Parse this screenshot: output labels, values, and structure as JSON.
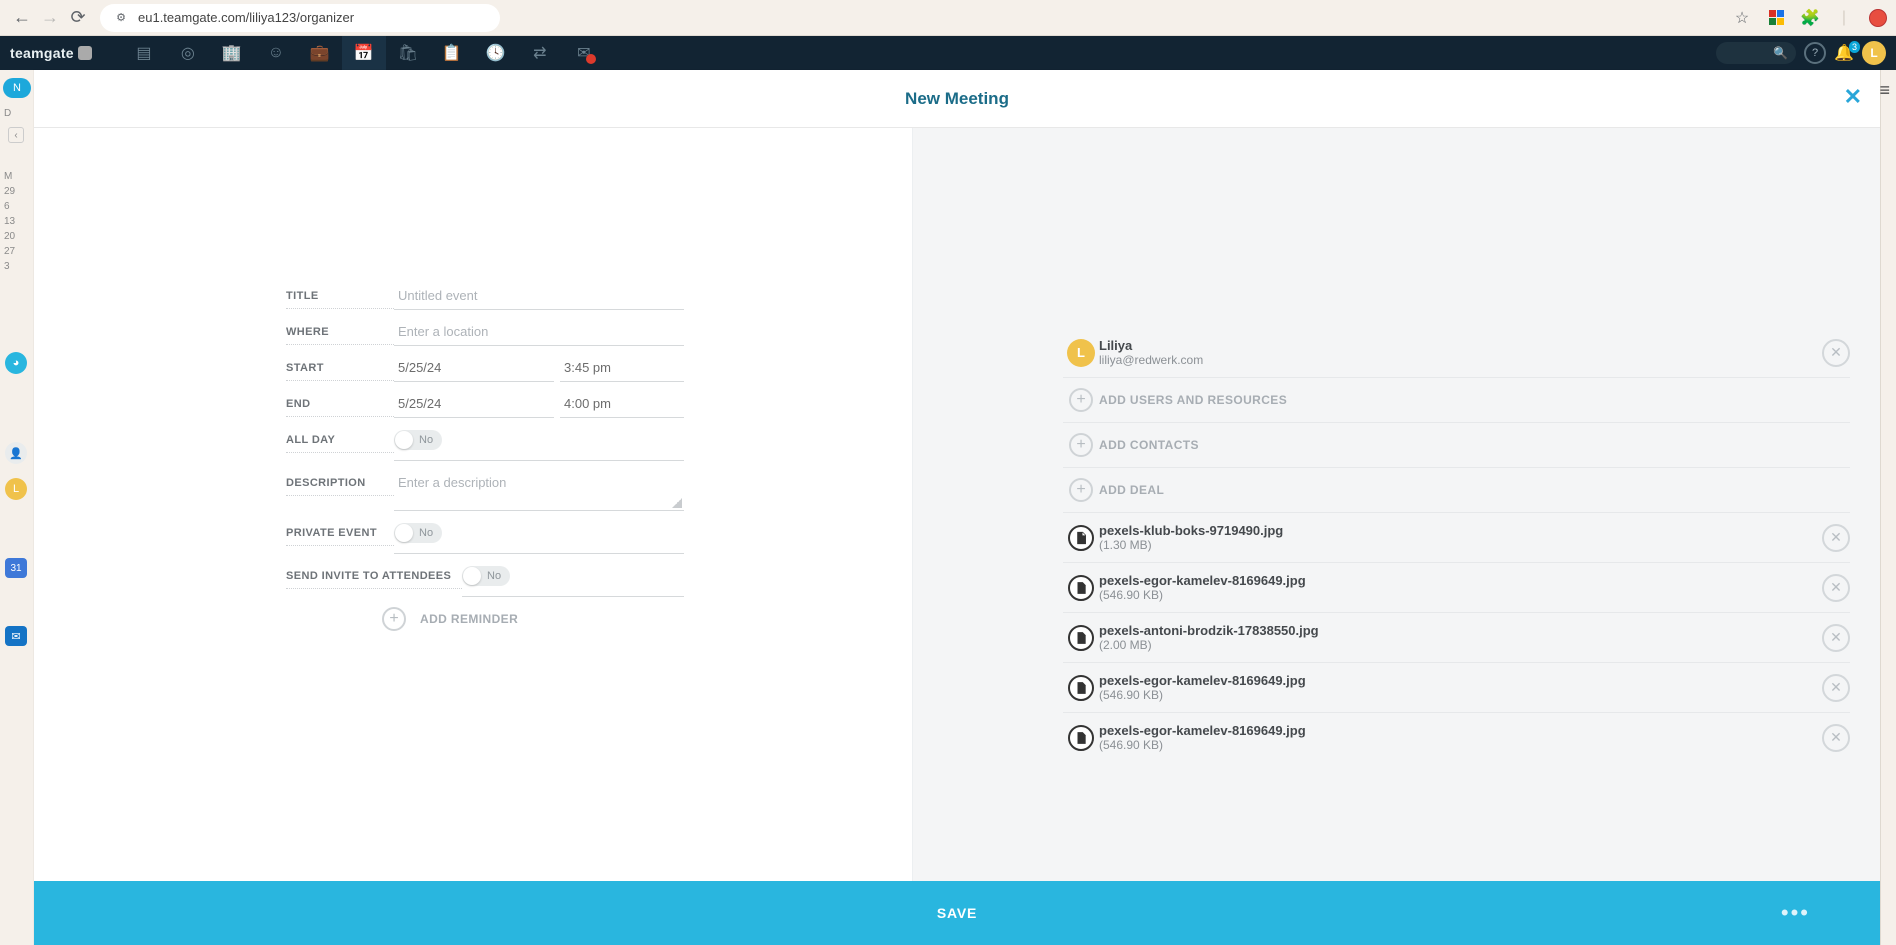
{
  "browser": {
    "url": "eu1.teamgate.com/liliya123/organizer"
  },
  "topbar": {
    "logo_text": "teamgate",
    "notif_count": "3",
    "avatar_initial": "L"
  },
  "under": {
    "new_btn": "N",
    "day_label": "D",
    "month_label": "M",
    "rows": [
      "29",
      "6",
      "13",
      "20",
      "27",
      "3"
    ],
    "google_cal": "31"
  },
  "modal": {
    "title": "New Meeting",
    "labels": {
      "title": "TITLE",
      "where": "WHERE",
      "start": "START",
      "end": "END",
      "allday": "ALL DAY",
      "description": "DESCRIPTION",
      "private": "PRIVATE EVENT",
      "send_invite": "SEND INVITE TO ATTENDEES",
      "add_reminder": "ADD REMINDER"
    },
    "placeholders": {
      "title": "Untitled event",
      "where": "Enter a location",
      "description": "Enter a description"
    },
    "values": {
      "start_date": "5/25/24",
      "start_time": "3:45 pm",
      "end_date": "5/25/24",
      "end_time": "4:00 pm",
      "allday": "No",
      "private": "No",
      "send_invite": "No"
    },
    "side": {
      "attendee": {
        "name": "Liliya",
        "email": "liliya@redwerk.com",
        "initial": "L"
      },
      "actions": {
        "add_users": "ADD USERS AND RESOURCES",
        "add_contacts": "ADD CONTACTS",
        "add_deal": "ADD DEAL"
      },
      "attachments": [
        {
          "name": "pexels-klub-boks-9719490.jpg",
          "size": "(1.30 MB)"
        },
        {
          "name": "pexels-egor-kamelev-8169649.jpg",
          "size": "(546.90 KB)"
        },
        {
          "name": "pexels-antoni-brodzik-17838550.jpg",
          "size": "(2.00 MB)"
        },
        {
          "name": "pexels-egor-kamelev-8169649.jpg",
          "size": "(546.90 KB)"
        },
        {
          "name": "pexels-egor-kamelev-8169649.jpg",
          "size": "(546.90 KB)"
        }
      ]
    },
    "save": "SAVE"
  }
}
